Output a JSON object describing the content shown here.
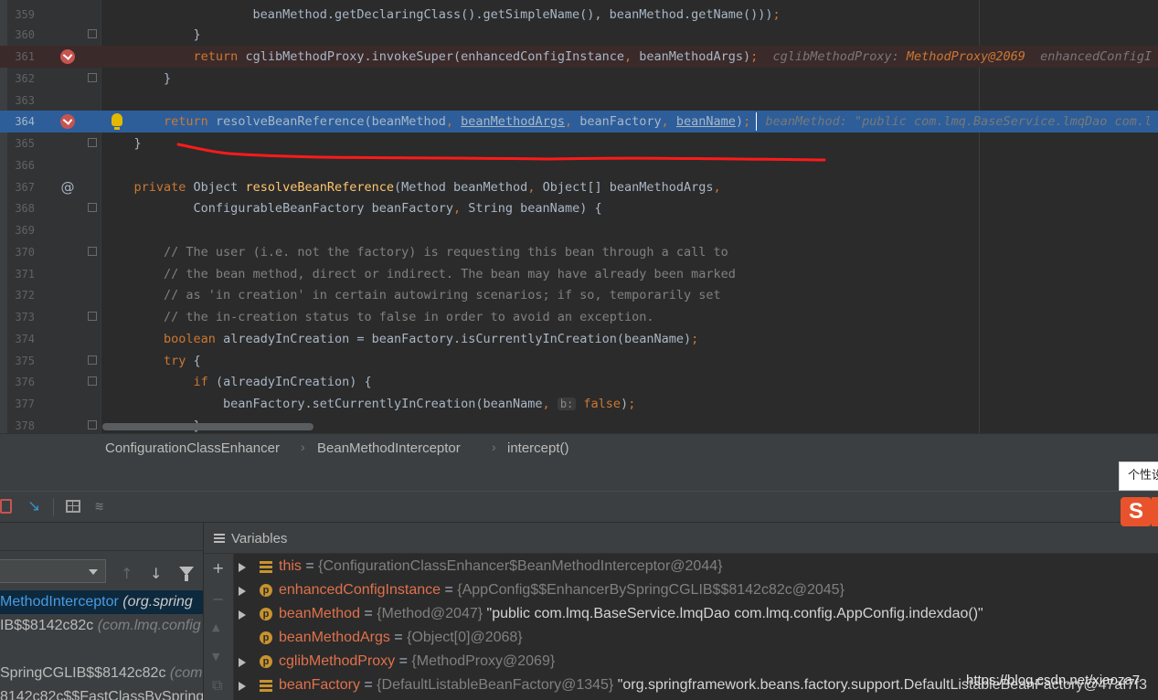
{
  "editor": {
    "lines": [
      {
        "num": "359",
        "parts": [
          {
            "t": "                    beanMethod.getDeclaringClass().getSimpleName(), beanMethod.getName()))",
            "c": ""
          },
          {
            "t": ";",
            "c": "kw"
          }
        ]
      },
      {
        "num": "360",
        "parts": [
          {
            "t": "            }",
            "c": ""
          }
        ]
      },
      {
        "num": "361",
        "parts": [
          {
            "t": "            ",
            "c": ""
          },
          {
            "t": "return ",
            "c": "kw"
          },
          {
            "t": "cglibMethodProxy.invokeSuper(enhancedConfigInstance",
            "c": ""
          },
          {
            "t": ", ",
            "c": "kw"
          },
          {
            "t": "beanMethodArgs)",
            "c": ""
          },
          {
            "t": ";",
            "c": "kw"
          },
          {
            "t": "  cglibMethodProxy: ",
            "c": "hint"
          },
          {
            "t": "MethodProxy@2069",
            "c": "hint-obj"
          },
          {
            "t": "  enhancedConfigI",
            "c": "hint"
          }
        ]
      },
      {
        "num": "362",
        "parts": [
          {
            "t": "        }",
            "c": ""
          }
        ]
      },
      {
        "num": "363",
        "parts": [
          {
            "t": "",
            "c": ""
          }
        ]
      },
      {
        "num": "364",
        "parts": [
          {
            "t": "        ",
            "c": ""
          },
          {
            "t": "return ",
            "c": "kw"
          },
          {
            "t": "resolveBeanReference(beanMethod",
            "c": ""
          },
          {
            "t": ", ",
            "c": "kw"
          },
          {
            "t": "beanMethodArgs",
            "c": "ul"
          },
          {
            "t": ", ",
            "c": "kw"
          },
          {
            "t": "beanFactory",
            "c": ""
          },
          {
            "t": ", ",
            "c": "kw"
          },
          {
            "t": "beanName",
            "c": "ul"
          },
          {
            "t": ")",
            "c": ""
          },
          {
            "t": ";",
            "c": "kw"
          },
          {
            "t": "  beanMethod: \"public com.lmq.BaseService.lmqDao com.l",
            "c": "hint"
          }
        ]
      },
      {
        "num": "365",
        "parts": [
          {
            "t": "    }",
            "c": ""
          }
        ]
      },
      {
        "num": "366",
        "parts": [
          {
            "t": "",
            "c": ""
          }
        ]
      },
      {
        "num": "367",
        "parts": [
          {
            "t": "    ",
            "c": ""
          },
          {
            "t": "private ",
            "c": "kw"
          },
          {
            "t": "Object ",
            "c": ""
          },
          {
            "t": "resolveBeanReference",
            "c": "fn"
          },
          {
            "t": "(Method beanMethod",
            "c": ""
          },
          {
            "t": ", ",
            "c": "kw"
          },
          {
            "t": "Object[] beanMethodArgs",
            "c": ""
          },
          {
            "t": ",",
            "c": "kw"
          }
        ]
      },
      {
        "num": "368",
        "parts": [
          {
            "t": "            ConfigurableBeanFactory beanFactory",
            "c": ""
          },
          {
            "t": ", ",
            "c": "kw"
          },
          {
            "t": "String beanName) {",
            "c": ""
          }
        ]
      },
      {
        "num": "369",
        "parts": [
          {
            "t": "",
            "c": ""
          }
        ]
      },
      {
        "num": "370",
        "parts": [
          {
            "t": "        ",
            "c": ""
          },
          {
            "t": "// The user (i.e. not the factory) is requesting this bean through a call to",
            "c": "cm"
          }
        ]
      },
      {
        "num": "371",
        "parts": [
          {
            "t": "        ",
            "c": ""
          },
          {
            "t": "// the bean method, direct or indirect. The bean may have already been marked",
            "c": "cm"
          }
        ]
      },
      {
        "num": "372",
        "parts": [
          {
            "t": "        ",
            "c": ""
          },
          {
            "t": "// as 'in creation' in certain autowiring scenarios; if so, temporarily set",
            "c": "cm"
          }
        ]
      },
      {
        "num": "373",
        "parts": [
          {
            "t": "        ",
            "c": ""
          },
          {
            "t": "// the in-creation status to false in order to avoid an exception.",
            "c": "cm"
          }
        ]
      },
      {
        "num": "374",
        "parts": [
          {
            "t": "        ",
            "c": ""
          },
          {
            "t": "boolean ",
            "c": "kw"
          },
          {
            "t": "alreadyInCreation = beanFactory.isCurrentlyInCreation(beanName)",
            "c": ""
          },
          {
            "t": ";",
            "c": "kw"
          }
        ]
      },
      {
        "num": "375",
        "parts": [
          {
            "t": "        ",
            "c": ""
          },
          {
            "t": "try ",
            "c": "kw"
          },
          {
            "t": "{",
            "c": ""
          }
        ]
      },
      {
        "num": "376",
        "parts": [
          {
            "t": "            ",
            "c": ""
          },
          {
            "t": "if ",
            "c": "kw"
          },
          {
            "t": "(alreadyInCreation) {",
            "c": ""
          }
        ]
      },
      {
        "num": "377",
        "parts": [
          {
            "t": "                beanFactory.setCurrentlyInCreation(beanName",
            "c": ""
          },
          {
            "t": ", ",
            "c": "kw"
          },
          {
            "t": "b:",
            "c": "param-hint"
          },
          {
            "t": " ",
            "c": ""
          },
          {
            "t": "false",
            "c": "kw"
          },
          {
            "t": ")",
            "c": ""
          },
          {
            "t": ";",
            "c": "kw"
          }
        ]
      },
      {
        "num": "378",
        "parts": [
          {
            "t": "            }",
            "c": ""
          }
        ]
      }
    ]
  },
  "breadcrumb": {
    "items": [
      "ConfigurationClassEnhancer",
      "BeanMethodInterceptor",
      "intercept()"
    ],
    "separator": "›"
  },
  "debug_toolbar": {
    "step_icon": "↘",
    "columns_icon": "≋"
  },
  "frames": {
    "up_arrow": "↑",
    "down_arrow": "↓",
    "items": [
      {
        "main": "MethodInterceptor ",
        "pkg": "(org.spring",
        "selected": true
      },
      {
        "main": "IB$$8142c82c ",
        "pkg": "(com.lmq.config",
        "selected": false
      },
      {
        "main": "",
        "pkg": "",
        "selected": false
      },
      {
        "main": "SpringCGLIB$$8142c82c ",
        "pkg": "(com.",
        "selected": false
      },
      {
        "main": "8142c82c$$FastClassBySpring",
        "pkg": "",
        "selected": false
      }
    ]
  },
  "variables": {
    "title": "Variables",
    "side": {
      "add": "+",
      "remove": "−",
      "up": "▲",
      "down": "▼",
      "copy": "⧉"
    },
    "items": [
      {
        "icon": "lines",
        "name": "this",
        "eq": " = ",
        "ref": "{ConfigurationClassEnhancer$BeanMethodInterceptor@2044}",
        "str": "",
        "expandable": true
      },
      {
        "icon": "p",
        "name": "enhancedConfigInstance",
        "eq": " = ",
        "ref": "{AppConfig$$EnhancerBySpringCGLIB$$8142c82c@2045}",
        "str": "",
        "expandable": true
      },
      {
        "icon": "p",
        "name": "beanMethod",
        "eq": " = ",
        "ref": "{Method@2047} ",
        "str": "\"public com.lmq.BaseService.lmqDao com.lmq.config.AppConfig.indexdao()\"",
        "expandable": true
      },
      {
        "icon": "p",
        "name": "beanMethodArgs",
        "eq": " = ",
        "ref": "{Object[0]@2068}",
        "str": "",
        "expandable": false
      },
      {
        "icon": "p",
        "name": "cglibMethodProxy",
        "eq": " = ",
        "ref": "{MethodProxy@2069}",
        "str": "",
        "expandable": true
      },
      {
        "icon": "lines",
        "name": "beanFactory",
        "eq": " = ",
        "ref": "{DefaultListableBeanFactory@1345} ",
        "str": "\"org.springframework.beans.factory.support.DefaultListableBeanFactory@47af7f3",
        "expandable": true
      }
    ]
  },
  "ime": {
    "popup_text": "个性设",
    "logo_text": "S"
  },
  "watermark": "https://blog.csdn.net/xiaoza7",
  "colors": {
    "editor_bg": "#2b2b2b",
    "exec_line": "#2d5e9a",
    "breakpoint": "#c75450",
    "keyword": "#cc7832",
    "annotation_red": "#ff1a1a"
  }
}
